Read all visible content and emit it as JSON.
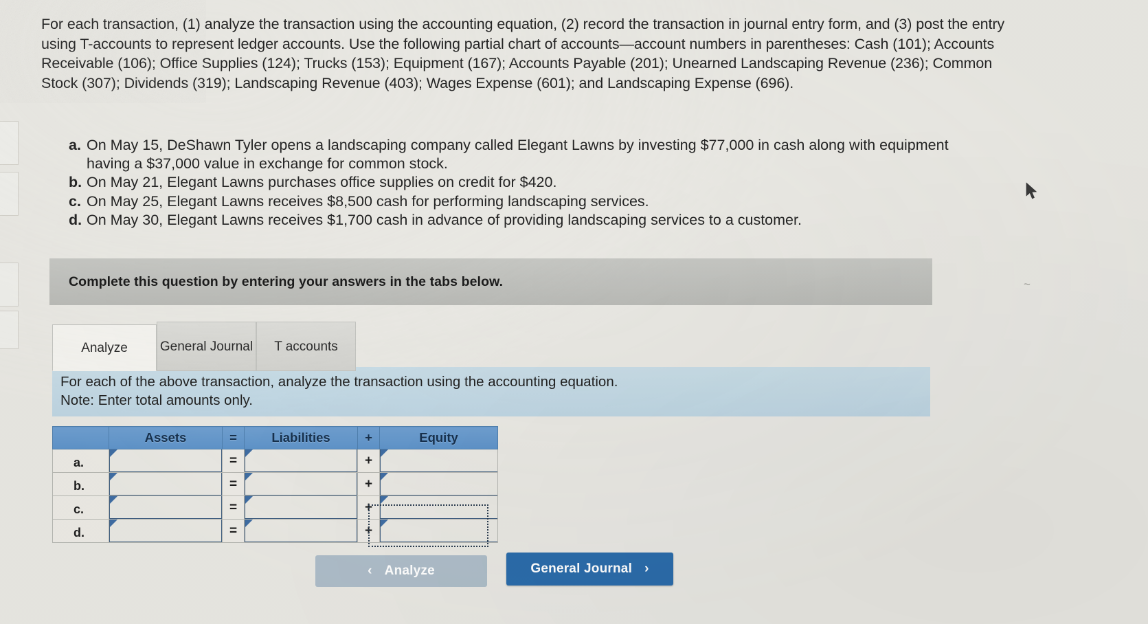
{
  "intro": {
    "paragraph": "For each transaction, (1) analyze the transaction using the accounting equation, (2) record the transaction in journal entry form, and (3) post the entry using T-accounts to represent ledger accounts. Use the following partial chart of accounts—account numbers in parentheses: Cash (101); Accounts Receivable (106); Office Supplies (124); Trucks (153); Equipment (167); Accounts Payable (201); Unearned Landscaping Revenue (236); Common Stock (307); Dividends (319); Landscaping Revenue (403); Wages Expense (601); and Landscaping Expense (696)."
  },
  "transactions": [
    {
      "letter": "a.",
      "text": "On May 15, DeShawn Tyler opens a landscaping company called Elegant Lawns by investing $77,000 in cash along with equipment having a $37,000 value in exchange for common stock."
    },
    {
      "letter": "b.",
      "text": "On May 21, Elegant Lawns purchases office supplies on credit for $420."
    },
    {
      "letter": "c.",
      "text": "On May 25, Elegant Lawns receives $8,500 cash for performing landscaping services."
    },
    {
      "letter": "d.",
      "text": "On May 30, Elegant Lawns receives $1,700 cash in advance of providing landscaping services to a customer."
    }
  ],
  "banner": {
    "text": "Complete this question by entering your answers in the tabs below."
  },
  "tabs": [
    {
      "label": "Analyze",
      "active": true
    },
    {
      "label": "General Journal",
      "active": false
    },
    {
      "label": "T accounts",
      "active": false
    }
  ],
  "instruction": {
    "line1": "For each of the above transaction, analyze the transaction using the accounting equation.",
    "line2": "Note: Enter total amounts only."
  },
  "table": {
    "headers": [
      "",
      "Assets",
      "=",
      "Liabilities",
      "+",
      "Equity"
    ],
    "rows": [
      {
        "label": "a.",
        "assets": "",
        "eq": "=",
        "liabilities": "",
        "plus": "+",
        "equity": ""
      },
      {
        "label": "b.",
        "assets": "",
        "eq": "=",
        "liabilities": "",
        "plus": "+",
        "equity": ""
      },
      {
        "label": "c.",
        "assets": "",
        "eq": "=",
        "liabilities": "",
        "plus": "+",
        "equity": ""
      },
      {
        "label": "d.",
        "assets": "",
        "eq": "=",
        "liabilities": "",
        "plus": "+",
        "equity": ""
      }
    ]
  },
  "nav": {
    "prev_label": "Analyze",
    "prev_chevron": "‹",
    "next_label": "General Journal",
    "next_chevron": "›"
  },
  "colors": {
    "header_blue": "#5e93c9",
    "panel_blue": "#c2d8e4",
    "primary_button": "#2b6cab",
    "disabled_button": "#aebdc9",
    "banner_gray": "#bfc0bc",
    "cell_border_blue": "#3f5e80"
  }
}
